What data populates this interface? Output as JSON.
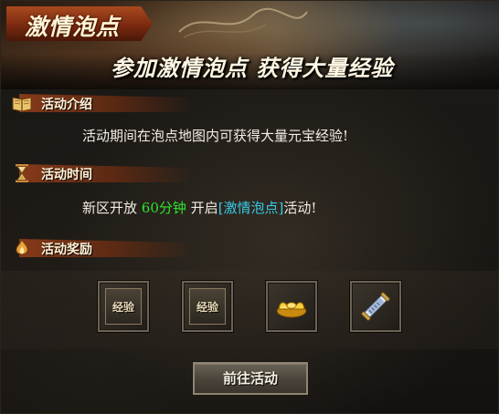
{
  "banner": {
    "title": "激情泡点",
    "subtitle": "参加激情泡点 获得大量经验"
  },
  "sections": {
    "intro": {
      "title": "活动介绍",
      "text": "活动期间在泡点地图内可获得大量元宝经验!"
    },
    "time": {
      "title": "活动时间",
      "text_prefix": "新区开放",
      "highlight_time": "60分钟",
      "text_mid": "开启",
      "event_link": "[激情泡点]",
      "text_suffix": "活动!"
    },
    "rewards": {
      "title": "活动奖励",
      "items": [
        {
          "label": "经验",
          "icon": "exp-icon"
        },
        {
          "label": "经验",
          "icon": "exp-icon"
        },
        {
          "icon": "gold-ingot-icon"
        },
        {
          "icon": "scroll-icon"
        }
      ]
    }
  },
  "actions": {
    "go_label": "前往活动"
  },
  "colors": {
    "highlight_green": "#2ee62e",
    "link_cyan": "#39c9e6",
    "header_bar": "#8c3c19"
  }
}
